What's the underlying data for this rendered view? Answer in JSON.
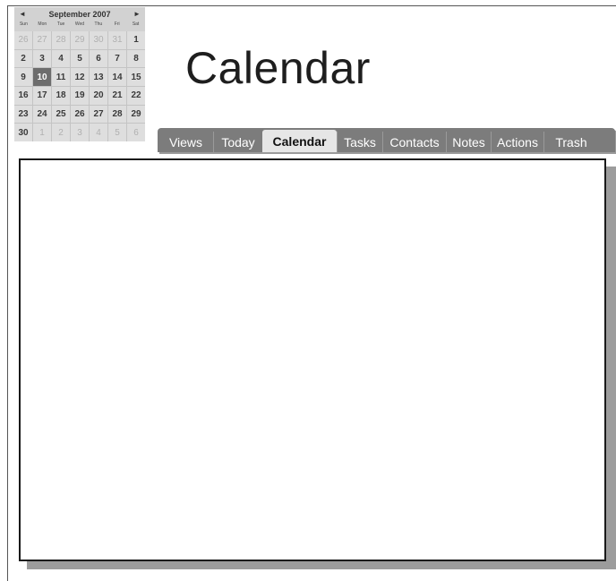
{
  "mini_calendar": {
    "title": "September 2007",
    "prev": "◄",
    "next": "►",
    "weekdays": [
      "Sun",
      "Mon",
      "Tue",
      "Wed",
      "Thu",
      "Fri",
      "Sat"
    ],
    "weeks": [
      [
        {
          "d": "26",
          "muted": true
        },
        {
          "d": "27",
          "muted": true
        },
        {
          "d": "28",
          "muted": true
        },
        {
          "d": "29",
          "muted": true
        },
        {
          "d": "30",
          "muted": true
        },
        {
          "d": "31",
          "muted": true
        },
        {
          "d": "1"
        }
      ],
      [
        {
          "d": "2"
        },
        {
          "d": "3"
        },
        {
          "d": "4"
        },
        {
          "d": "5"
        },
        {
          "d": "6"
        },
        {
          "d": "7"
        },
        {
          "d": "8"
        }
      ],
      [
        {
          "d": "9"
        },
        {
          "d": "10",
          "today": true
        },
        {
          "d": "11"
        },
        {
          "d": "12"
        },
        {
          "d": "13"
        },
        {
          "d": "14"
        },
        {
          "d": "15"
        }
      ],
      [
        {
          "d": "16"
        },
        {
          "d": "17"
        },
        {
          "d": "18"
        },
        {
          "d": "19"
        },
        {
          "d": "20"
        },
        {
          "d": "21"
        },
        {
          "d": "22"
        }
      ],
      [
        {
          "d": "23"
        },
        {
          "d": "24"
        },
        {
          "d": "25"
        },
        {
          "d": "26"
        },
        {
          "d": "27"
        },
        {
          "d": "28"
        },
        {
          "d": "29"
        }
      ],
      [
        {
          "d": "30"
        },
        {
          "d": "1",
          "muted": true
        },
        {
          "d": "2",
          "muted": true
        },
        {
          "d": "3",
          "muted": true
        },
        {
          "d": "4",
          "muted": true
        },
        {
          "d": "5",
          "muted": true
        },
        {
          "d": "6",
          "muted": true
        }
      ]
    ]
  },
  "page_title": "Calendar",
  "tabs": [
    {
      "label": "Views",
      "active": false
    },
    {
      "label": "Today",
      "active": false
    },
    {
      "label": "Calendar",
      "active": true
    },
    {
      "label": "Tasks",
      "active": false
    },
    {
      "label": "Contacts",
      "active": false
    },
    {
      "label": "Notes",
      "active": false
    },
    {
      "label": "Actions",
      "active": false
    },
    {
      "label": "Trash",
      "active": false
    }
  ],
  "colors": {
    "tab_bar": "#7c7c7c",
    "tab_active": "#e6e6e6",
    "today_highlight": "#6d6d6d",
    "pane_shadow": "#9c9c9c"
  }
}
